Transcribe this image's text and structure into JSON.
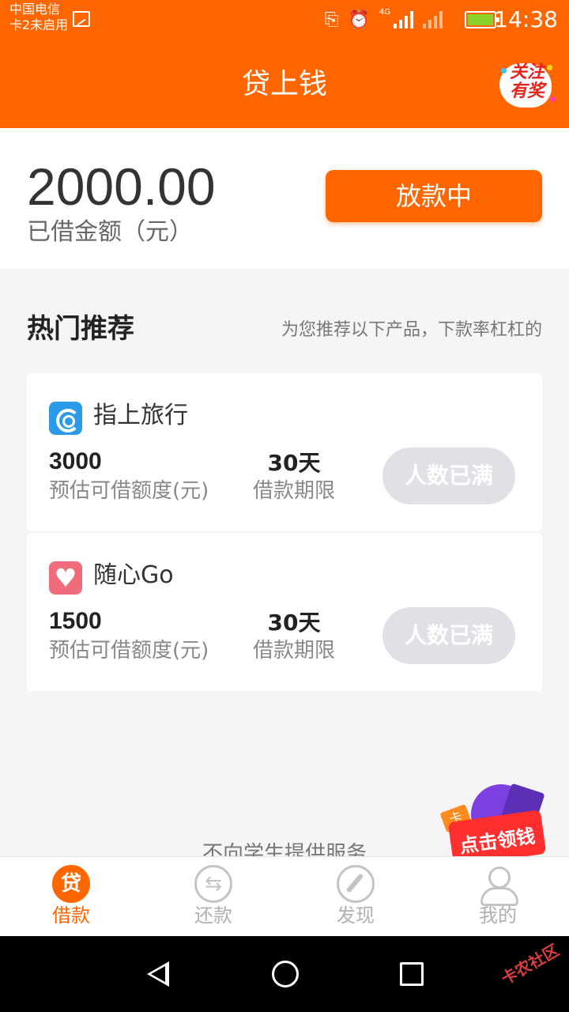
{
  "status_bar": {
    "carrier_line1": "中国电信",
    "carrier_line2": "卡2未启用",
    "network": "4G",
    "time": "14:38"
  },
  "header": {
    "title": "贷上钱",
    "follow_badge": "关注有奖"
  },
  "loan_summary": {
    "amount": "2000.00",
    "amount_label": "已借金额（元）",
    "status_button": "放款中"
  },
  "recommend": {
    "title": "热门推荐",
    "subtitle": "为您推荐以下产品，下款率杠杠的",
    "products": [
      {
        "name": "指上旅行",
        "limit": "3000",
        "limit_label": "预估可借额度(元)",
        "term": "30天",
        "term_label": "借款期限",
        "action": "人数已满"
      },
      {
        "name": "随心Go",
        "limit": "1500",
        "limit_label": "预估可借额度(元)",
        "term": "30天",
        "term_label": "借款期限",
        "action": "人数已满"
      }
    ]
  },
  "footnote": "不向学生提供服务",
  "promo": {
    "text": "点击领钱",
    "tag": "卡"
  },
  "tabbar": {
    "tabs": [
      {
        "label": "借款",
        "icon": "loan-icon",
        "glyph": "贷",
        "active": true
      },
      {
        "label": "还款",
        "icon": "repay-icon",
        "active": false
      },
      {
        "label": "发现",
        "icon": "compass-icon",
        "active": false
      },
      {
        "label": "我的",
        "icon": "user-icon",
        "active": false
      }
    ]
  },
  "watermark": "卡农社区",
  "colors": {
    "brand": "#ff6600",
    "disabled_button": "#dfe1e6",
    "background": "#f5f5f7"
  }
}
